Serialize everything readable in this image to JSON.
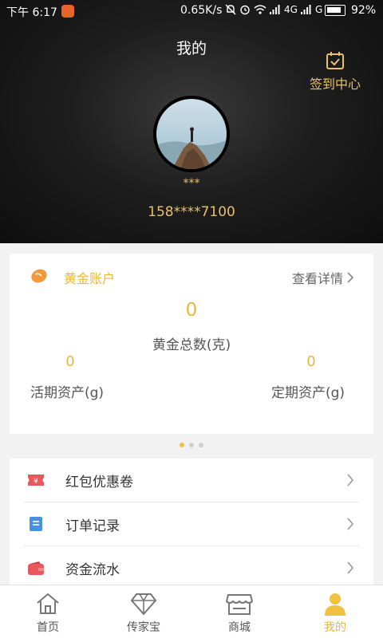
{
  "status_bar": {
    "time": "下午 6:17",
    "speed": "0.65K/s",
    "network": "4G",
    "network2": "G",
    "battery": "92%",
    "battery_level": 0.92
  },
  "header": {
    "title": "我的",
    "checkin_label": "签到中心",
    "nickname": "***",
    "phone": "158****7100"
  },
  "gold_account": {
    "title": "黄金账户",
    "detail_label": "查看详情",
    "total_value": "0",
    "total_label": "黄金总数(克)",
    "current_value": "0",
    "current_label": "活期资产(g)",
    "fixed_value": "0",
    "fixed_label": "定期资产(g)"
  },
  "pagination": {
    "count": 3,
    "active": 0
  },
  "menu": {
    "items": [
      {
        "label": "红包优惠卷",
        "icon": "coupon-icon"
      },
      {
        "label": "订单记录",
        "icon": "order-icon"
      },
      {
        "label": "资金流水",
        "icon": "wallet-icon"
      }
    ]
  },
  "tabbar": {
    "tabs": [
      {
        "label": "首页",
        "icon": "home-icon"
      },
      {
        "label": "传家宝",
        "icon": "diamond-icon"
      },
      {
        "label": "商城",
        "icon": "store-icon"
      },
      {
        "label": "我的",
        "icon": "user-icon",
        "active": true
      }
    ]
  },
  "colors": {
    "accent": "#e8b839",
    "header_gold": "#e8c06a"
  }
}
